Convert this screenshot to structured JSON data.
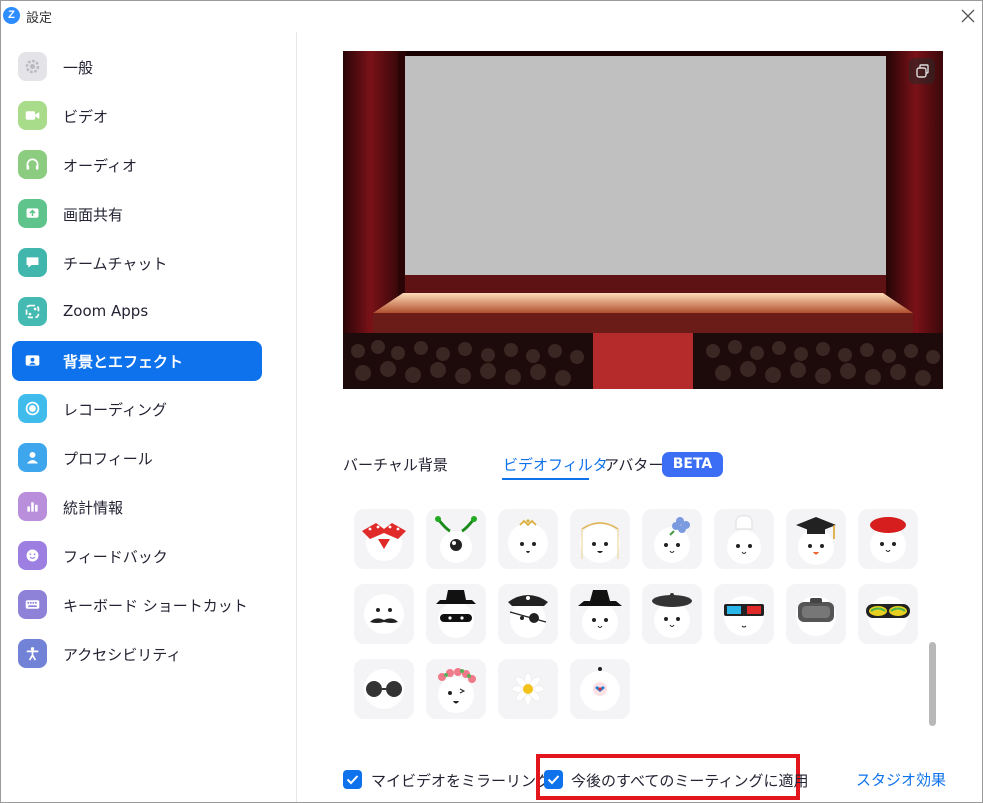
{
  "window": {
    "title": "設定",
    "app_logo": "Z"
  },
  "sidebar": {
    "items": [
      {
        "label": "一般",
        "icon": "gear-icon",
        "color": "#e8e8ec",
        "active": false
      },
      {
        "label": "ビデオ",
        "icon": "video-camera-icon",
        "color": "#8ecf7b",
        "active": false
      },
      {
        "label": "オーディオ",
        "icon": "headphones-icon",
        "color": "#8ecf7b",
        "active": false
      },
      {
        "label": "画面共有",
        "icon": "share-screen-icon",
        "color": "#5cc98a",
        "active": false
      },
      {
        "label": "チームチャット",
        "icon": "chat-bubble-icon",
        "color": "#43b8b0",
        "active": false
      },
      {
        "label": "Zoom Apps",
        "icon": "apps-icon",
        "color": "#43b8b0",
        "active": false
      },
      {
        "label": "背景とエフェクト",
        "icon": "portrait-icon",
        "color": "#0e72ed",
        "active": true
      },
      {
        "label": "レコーディング",
        "icon": "record-icon",
        "color": "#3ab7ea",
        "active": false
      },
      {
        "label": "プロフィール",
        "icon": "person-icon",
        "color": "#3aa4ea",
        "active": false
      },
      {
        "label": "統計情報",
        "icon": "bar-chart-icon",
        "color": "#b48ad8",
        "active": false
      },
      {
        "label": "フィードバック",
        "icon": "smiley-icon",
        "color": "#9a7ee0",
        "active": false
      },
      {
        "label": "キーボード ショートカット",
        "icon": "keyboard-icon",
        "color": "#8a80d6",
        "active": false
      },
      {
        "label": "アクセシビリティ",
        "icon": "accessibility-icon",
        "color": "#6f7fd4",
        "active": false
      }
    ]
  },
  "tabs": {
    "virtual_background": "バーチャル背景",
    "video_filter": "ビデオフィルタ",
    "avatar": "アバター",
    "beta_badge": "BETA"
  },
  "filters": [
    {
      "name": "red-polka-headband-filter"
    },
    {
      "name": "alien-antenna-filter"
    },
    {
      "name": "gold-tiara-filter"
    },
    {
      "name": "golden-veil-filter"
    },
    {
      "name": "blue-hydrangea-filter"
    },
    {
      "name": "chef-hat-filter"
    },
    {
      "name": "graduation-cap-filter"
    },
    {
      "name": "red-beret-filter"
    },
    {
      "name": "mustache-filter"
    },
    {
      "name": "bandit-hat-filter"
    },
    {
      "name": "pirate-filter"
    },
    {
      "name": "black-fedora-filter"
    },
    {
      "name": "black-beret-filter"
    },
    {
      "name": "3d-glasses-filter"
    },
    {
      "name": "vr-headset-filter"
    },
    {
      "name": "ski-goggles-filter"
    },
    {
      "name": "round-sunglasses-filter"
    },
    {
      "name": "flower-crown-filter"
    },
    {
      "name": "daisy-filter"
    },
    {
      "name": "bindi-filter"
    }
  ],
  "options": {
    "mirror_video": {
      "label": "マイビデオをミラーリング",
      "checked": true
    },
    "apply_future_meetings": {
      "label": "今後のすべてのミーティングに適用",
      "checked": true
    },
    "studio_effects": "スタジオ効果"
  },
  "colors": {
    "accent": "#0e72ed",
    "highlight_box": "#e3151d",
    "beta": "#3b6df5"
  }
}
